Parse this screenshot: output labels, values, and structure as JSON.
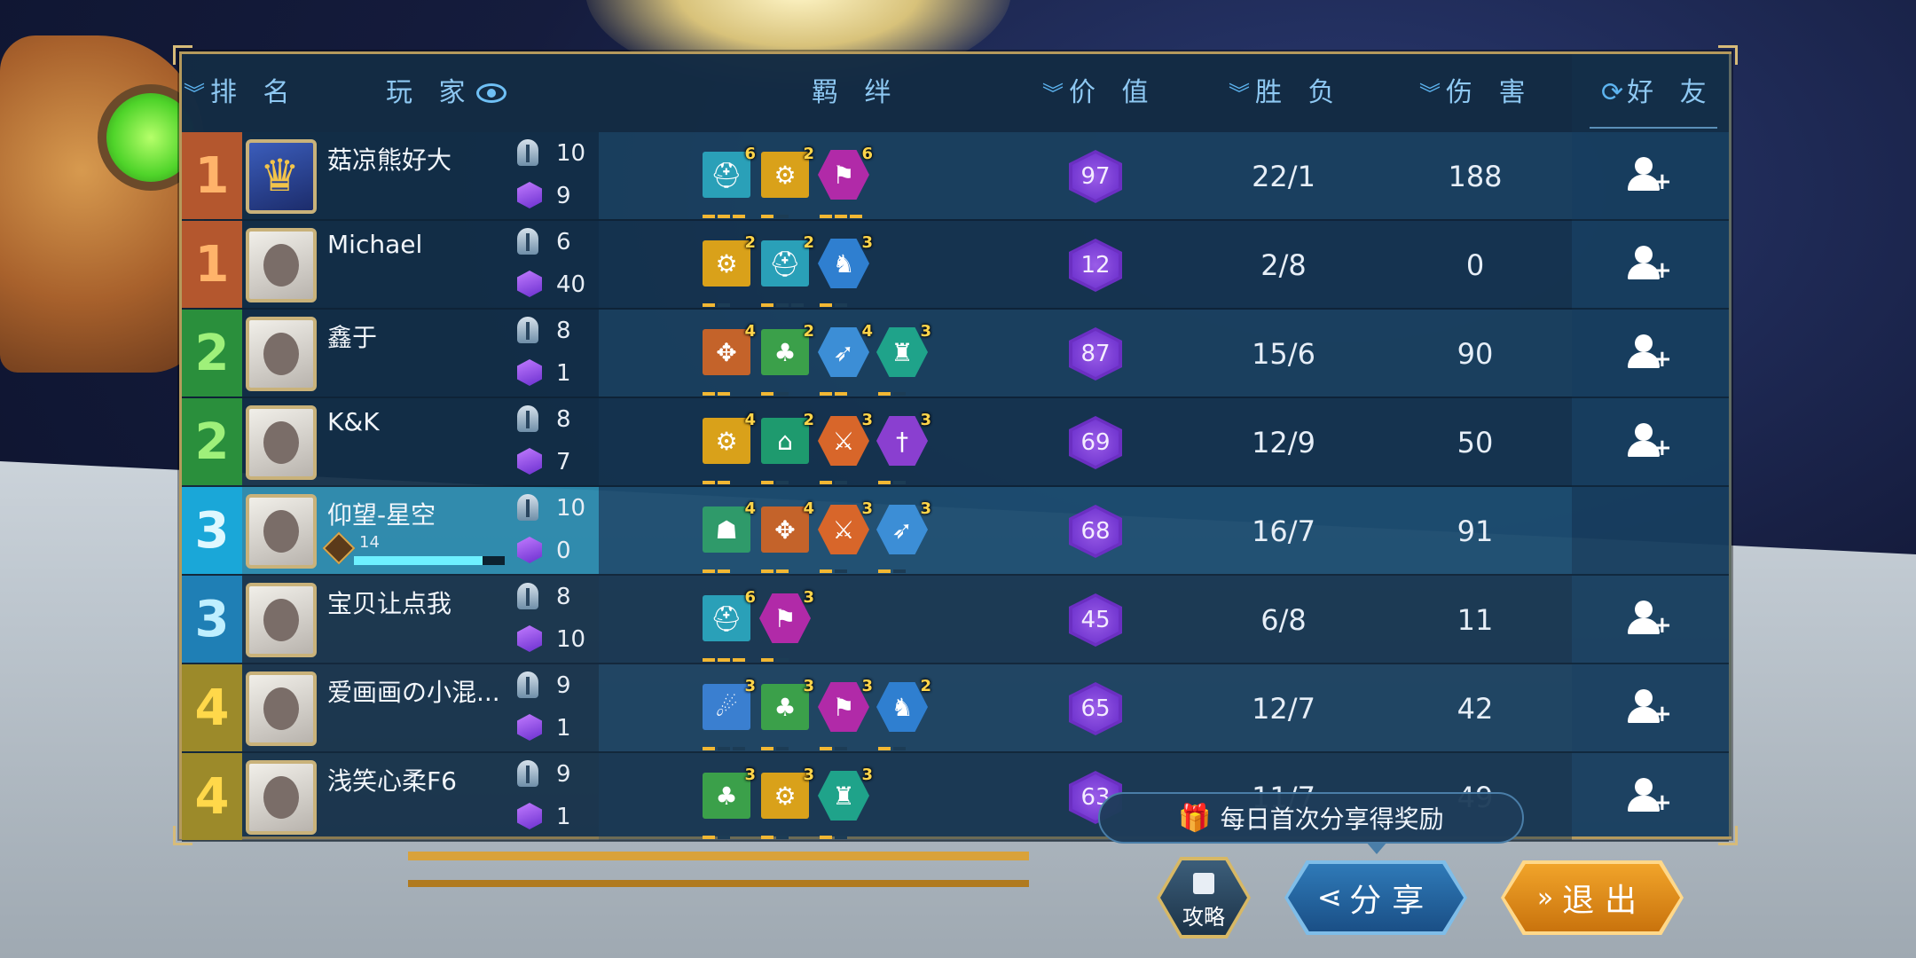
{
  "header": {
    "rank": "排 名",
    "player": "玩 家",
    "bond": "羁 绊",
    "value": "价 值",
    "winloss": "胜 负",
    "damage": "伤 害",
    "friend": "好 友"
  },
  "players": [
    {
      "rank": "1",
      "rank_color": "#b4572e",
      "name": "菇凉熊好大",
      "helm": "10",
      "gem": "9",
      "value": "97",
      "winloss": "22/1",
      "damage": "188",
      "avatar": "crown",
      "bonds": [
        {
          "icon": "viking-helm-icon",
          "count": "6",
          "color": "#2aa0b8",
          "shape": "sq",
          "pips": [
            1,
            1,
            1
          ]
        },
        {
          "icon": "gear-icon",
          "count": "2",
          "color": "#d9a11a",
          "shape": "sq",
          "pips": [
            1,
            0
          ]
        },
        {
          "icon": "banner-icon",
          "count": "6",
          "color": "#b12aa8",
          "shape": "hex",
          "pips": [
            1,
            1,
            1
          ]
        }
      ]
    },
    {
      "rank": "1",
      "rank_color": "#b4572e",
      "name": "Michael",
      "helm": "6",
      "gem": "40",
      "value": "12",
      "winloss": "2/8",
      "damage": "0",
      "avatar": "photo",
      "bonds": [
        {
          "icon": "gear-icon",
          "count": "2",
          "color": "#d9a11a",
          "shape": "sq",
          "pips": [
            1,
            0
          ]
        },
        {
          "icon": "viking-helm-icon",
          "count": "2",
          "color": "#2aa0b8",
          "shape": "sq",
          "pips": [
            1,
            0,
            0
          ]
        },
        {
          "icon": "knight-rider-icon",
          "count": "3",
          "color": "#2f7fd0",
          "shape": "hex",
          "pips": [
            1,
            0
          ]
        }
      ]
    },
    {
      "rank": "2",
      "rank_color": "#2a8f3c",
      "name": "鑫于",
      "helm": "8",
      "gem": "1",
      "value": "87",
      "winloss": "15/6",
      "damage": "90",
      "avatar": "anime",
      "bonds": [
        {
          "icon": "paw-icon",
          "count": "4",
          "color": "#c4632a",
          "shape": "sq",
          "pips": [
            1,
            1
          ]
        },
        {
          "icon": "tree-icon",
          "count": "2",
          "color": "#3ba04a",
          "shape": "sq",
          "pips": [
            1,
            0
          ]
        },
        {
          "icon": "wings-icon",
          "count": "4",
          "color": "#3c8ed6",
          "shape": "hex",
          "pips": [
            1,
            1
          ]
        },
        {
          "icon": "golem-icon",
          "count": "3",
          "color": "#1fa38a",
          "shape": "hex",
          "pips": [
            1,
            0
          ]
        }
      ]
    },
    {
      "rank": "2",
      "rank_color": "#2a8f3c",
      "name": "K&K",
      "helm": "8",
      "gem": "7",
      "value": "69",
      "winloss": "12/9",
      "damage": "50",
      "avatar": "anime",
      "bonds": [
        {
          "icon": "gear-icon",
          "count": "4",
          "color": "#d9a11a",
          "shape": "sq",
          "pips": [
            1,
            1
          ]
        },
        {
          "icon": "temple-icon",
          "count": "2",
          "color": "#1e9a6e",
          "shape": "sq",
          "pips": [
            1,
            0
          ]
        },
        {
          "icon": "sword-icon",
          "count": "3",
          "color": "#d8662a",
          "shape": "hex",
          "pips": [
            1,
            0
          ]
        },
        {
          "icon": "dagger-icon",
          "count": "3",
          "color": "#8a3fd0",
          "shape": "hex",
          "pips": [
            1,
            0
          ]
        }
      ]
    },
    {
      "rank": "3",
      "rank_color": "#1aa7d8",
      "name": "仰望-星空",
      "helm": "10",
      "gem": "0",
      "value": "68",
      "winloss": "16/7",
      "damage": "91",
      "avatar": "cartoon",
      "me": true,
      "level": "14",
      "level_progress": 0.85,
      "bonds": [
        {
          "icon": "orc-icon",
          "count": "4",
          "color": "#2f9a6a",
          "shape": "sq",
          "pips": [
            1,
            1
          ]
        },
        {
          "icon": "paw-icon",
          "count": "4",
          "color": "#c4632a",
          "shape": "sq",
          "pips": [
            1,
            1
          ]
        },
        {
          "icon": "sword-icon",
          "count": "3",
          "color": "#d8662a",
          "shape": "hex",
          "pips": [
            1,
            0
          ]
        },
        {
          "icon": "wings-icon",
          "count": "3",
          "color": "#3c8ed6",
          "shape": "hex",
          "pips": [
            1,
            0
          ]
        }
      ]
    },
    {
      "rank": "3",
      "rank_color": "#1f7fb5",
      "name": "宝贝让点我",
      "helm": "8",
      "gem": "10",
      "value": "45",
      "winloss": "6/8",
      "damage": "11",
      "avatar": "photo",
      "bonds": [
        {
          "icon": "viking-helm-icon",
          "count": "6",
          "color": "#2aa0b8",
          "shape": "sq",
          "pips": [
            1,
            1,
            1
          ]
        },
        {
          "icon": "banner-icon",
          "count": "3",
          "color": "#b12aa8",
          "shape": "hex",
          "pips": [
            1,
            0
          ]
        }
      ]
    },
    {
      "rank": "4",
      "rank_color": "#9c8a2a",
      "name": "爱画画の小混...",
      "helm": "9",
      "gem": "1",
      "value": "65",
      "winloss": "12/7",
      "damage": "42",
      "avatar": "photo",
      "bonds": [
        {
          "icon": "dragon-icon",
          "count": "3",
          "color": "#3a7fd0",
          "shape": "sq",
          "pips": [
            1,
            0,
            0
          ]
        },
        {
          "icon": "tree-icon",
          "count": "3",
          "color": "#3ba04a",
          "shape": "sq",
          "pips": [
            1,
            0
          ]
        },
        {
          "icon": "banner-icon",
          "count": "3",
          "color": "#b12aa8",
          "shape": "hex",
          "pips": [
            1,
            0
          ]
        },
        {
          "icon": "knight-rider-icon",
          "count": "2",
          "color": "#2f7fd0",
          "shape": "hex",
          "pips": [
            1,
            0
          ]
        }
      ]
    },
    {
      "rank": "4",
      "rank_color": "#9c8a2a",
      "name": "浅笑心柔F6",
      "helm": "9",
      "gem": "1",
      "value": "63",
      "winloss": "11/7",
      "damage": "49",
      "avatar": "anime",
      "bonds": [
        {
          "icon": "tree-icon",
          "count": "3",
          "color": "#3ba04a",
          "shape": "sq",
          "pips": [
            1,
            0
          ]
        },
        {
          "icon": "gear-icon",
          "count": "3",
          "color": "#d9a11a",
          "shape": "sq",
          "pips": [
            1,
            0
          ]
        },
        {
          "icon": "golem-icon",
          "count": "3",
          "color": "#1fa38a",
          "shape": "hex",
          "pips": [
            1,
            0
          ]
        }
      ]
    }
  ],
  "tooltip": "每日首次分享得奖励",
  "buttons": {
    "guide": "攻略",
    "share": "分享",
    "exit": "退出"
  }
}
